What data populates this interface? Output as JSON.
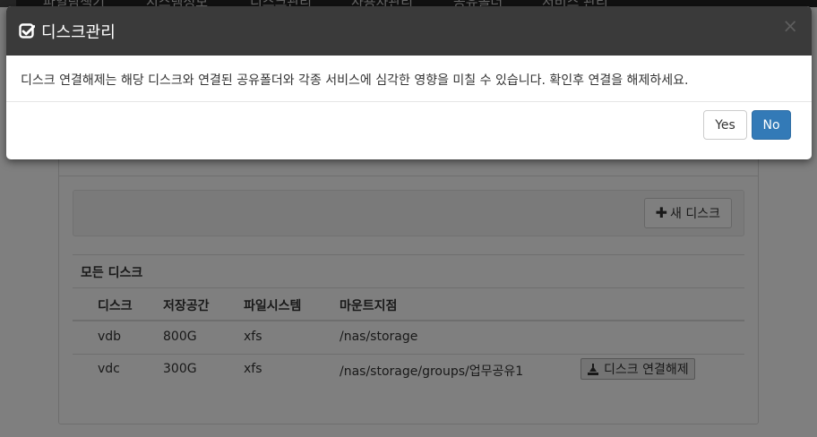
{
  "navbar": {
    "items": [
      "파일탐색기",
      "시스템정보",
      "디스크관리",
      "사용자관리",
      "공유폴더",
      "서비스 관리"
    ]
  },
  "page": {
    "new_disk_button": "새 디스크",
    "table": {
      "caption": "모든 디스크",
      "headers": [
        "디스크",
        "저장공간",
        "파일시스템",
        "마운트지점"
      ],
      "rows": [
        {
          "disk": "vdb",
          "size": "800G",
          "fs": "xfs",
          "mount": "/nas/storage"
        },
        {
          "disk": "vdc",
          "size": "300G",
          "fs": "xfs",
          "mount": "/nas/storage/groups/업무공유1",
          "action": "디스크 연결해제"
        }
      ]
    }
  },
  "modal": {
    "title": "디스크관리",
    "close": "×",
    "message": "디스크 연결해제는 해당 디스크와 연결된 공유폴더와 각종 서비스에 심각한 영향을 미칠 수 있습니다. 확인후 연결을 해제하세요.",
    "yes_label": "Yes",
    "no_label": "No"
  },
  "colors": {
    "header_bg": "#3a3a3a",
    "primary": "#337ab7"
  },
  "icons": [
    "check-square-icon",
    "plus-icon",
    "eject-icon",
    "close-icon"
  ]
}
